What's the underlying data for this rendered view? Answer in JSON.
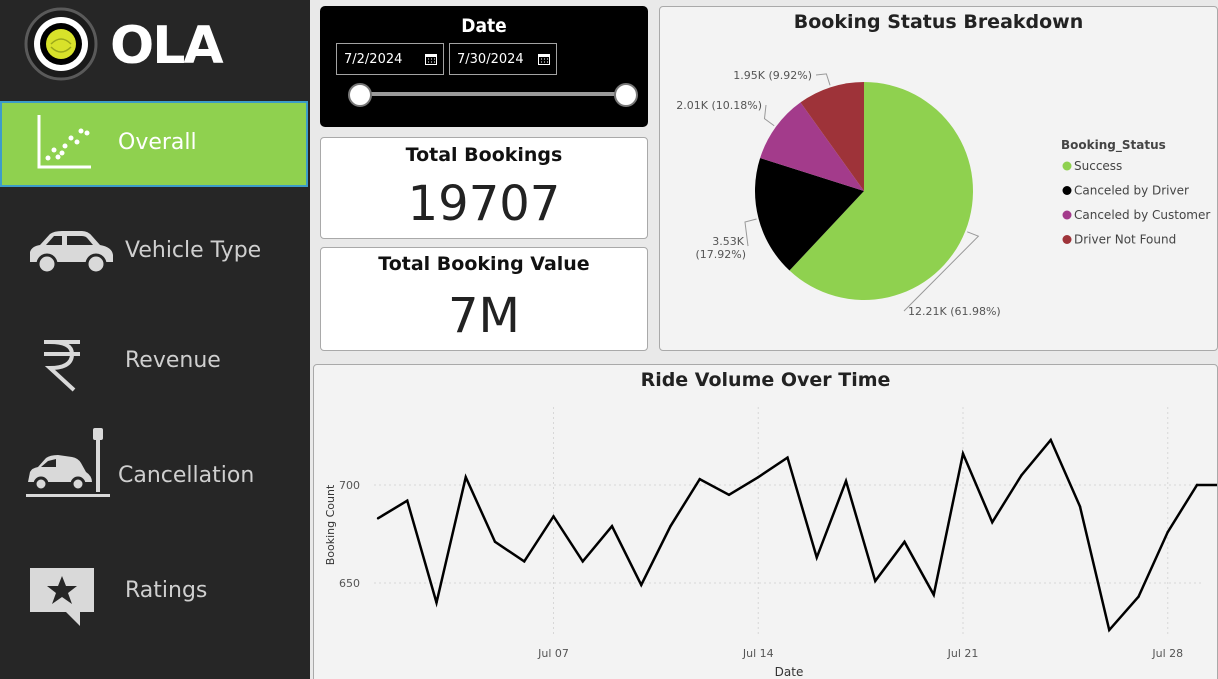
{
  "brand": {
    "name": "OLA"
  },
  "sidebar": {
    "items": [
      {
        "label": "Overall",
        "active": true,
        "icon": "scatter-chart-icon"
      },
      {
        "label": "Vehicle Type",
        "active": false,
        "icon": "car-icon"
      },
      {
        "label": "Revenue",
        "active": false,
        "icon": "rupee-icon"
      },
      {
        "label": "Cancellation",
        "active": false,
        "icon": "car-crash-icon"
      },
      {
        "label": "Ratings",
        "active": false,
        "icon": "star-comment-icon"
      }
    ]
  },
  "date_filter": {
    "title": "Date",
    "start": "7/2/2024",
    "end": "7/30/2024"
  },
  "kpis": {
    "total_bookings": {
      "title": "Total Bookings",
      "value": "19707"
    },
    "total_booking_value": {
      "title": "Total Booking Value",
      "value": "7M"
    }
  },
  "colors": {
    "success": "#8fd14f",
    "canceled_by_driver": "#000000",
    "canceled_by_customer": "#a33b8b",
    "driver_not_found": "#9e3339",
    "line": "#000000",
    "sidebar_bg": "#262626",
    "active_nav": "#8fd14f"
  },
  "chart_data": [
    {
      "type": "pie",
      "title": "Booking Status Breakdown",
      "legend_title": "Booking_Status",
      "legend_position": "right",
      "slices": [
        {
          "name": "Success",
          "value": 12210,
          "label": "12.21K (61.98%)",
          "percent": 61.98
        },
        {
          "name": "Canceled by Driver",
          "value": 3530,
          "label": "3.53K (17.92%)",
          "percent": 17.92
        },
        {
          "name": "Canceled by Customer",
          "value": 2010,
          "label": "2.01K (10.18%)",
          "percent": 10.18
        },
        {
          "name": "Driver Not Found",
          "value": 1950,
          "label": "1.95K (9.92%)",
          "percent": 9.92
        }
      ]
    },
    {
      "type": "line",
      "title": "Ride Volume Over Time",
      "xlabel": "Date",
      "ylabel": "Booking Count",
      "x_ticks": [
        "Jul 07",
        "Jul 14",
        "Jul 21",
        "Jul 28"
      ],
      "y_ticks": [
        650,
        700
      ],
      "x": [
        "2024-07-01",
        "2024-07-02",
        "2024-07-03",
        "2024-07-04",
        "2024-07-05",
        "2024-07-06",
        "2024-07-07",
        "2024-07-08",
        "2024-07-09",
        "2024-07-10",
        "2024-07-11",
        "2024-07-12",
        "2024-07-13",
        "2024-07-14",
        "2024-07-15",
        "2024-07-16",
        "2024-07-17",
        "2024-07-18",
        "2024-07-19",
        "2024-07-20",
        "2024-07-21",
        "2024-07-22",
        "2024-07-23",
        "2024-07-24",
        "2024-07-25",
        "2024-07-26",
        "2024-07-27",
        "2024-07-28",
        "2024-07-29",
        "2024-07-30"
      ],
      "values": [
        683,
        692,
        640,
        704,
        671,
        661,
        684,
        661,
        679,
        649,
        679,
        703,
        695,
        704,
        714,
        663,
        702,
        651,
        671,
        644,
        716,
        681,
        705,
        723,
        689,
        626,
        643,
        676,
        700,
        700
      ],
      "grid": true
    }
  ]
}
